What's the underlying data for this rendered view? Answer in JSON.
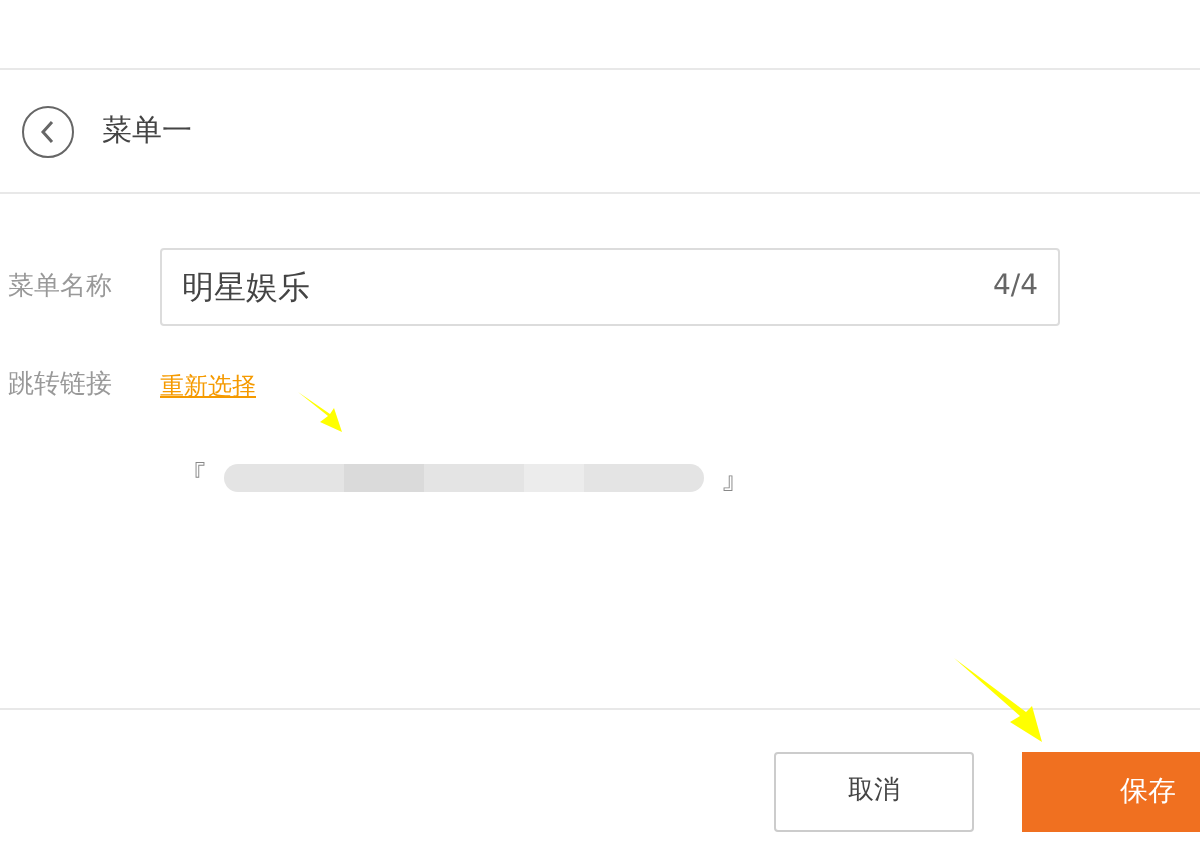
{
  "header": {
    "title": "菜单一"
  },
  "form": {
    "name_label": "菜单名称",
    "name_value": "明星娱乐",
    "name_count": "4/4",
    "link_label": "跳转链接",
    "link_action": "重新选择",
    "link_open": "『",
    "link_close": "』"
  },
  "buttons": [
    {
      "kind": "secondary",
      "label": "取消"
    },
    {
      "kind": "primary",
      "label": "保存"
    }
  ]
}
